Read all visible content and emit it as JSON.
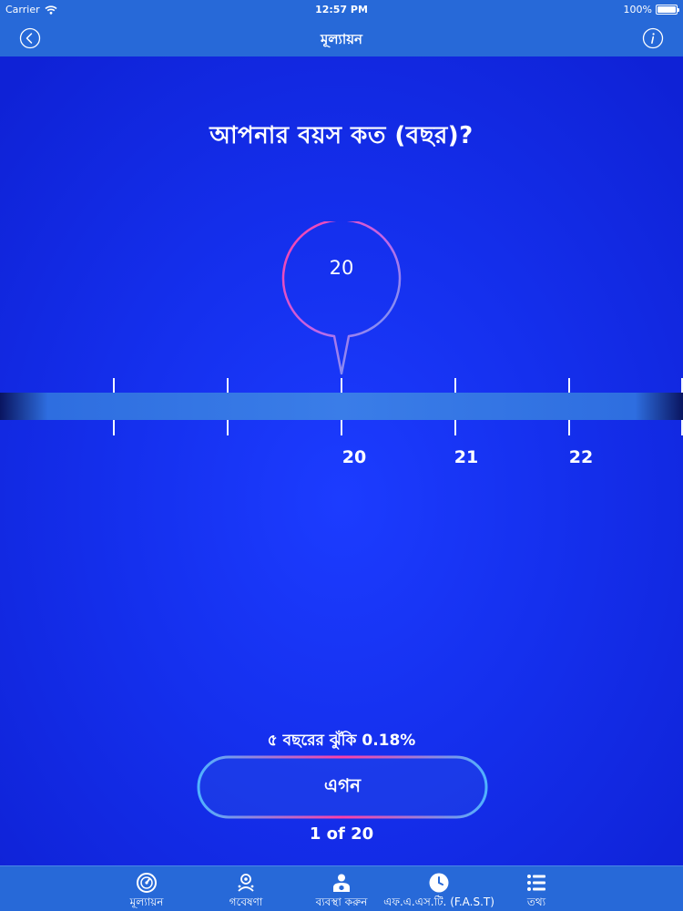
{
  "status_bar": {
    "carrier": "Carrier",
    "time": "12:57 PM",
    "battery": "100%"
  },
  "nav": {
    "title": "মূল্যায়ন",
    "back_icon": "chevron-left-circle-icon",
    "info_icon": "info-circle-icon"
  },
  "question": "আপনার বয়স কত (বছর)?",
  "picker": {
    "selected_value": "20",
    "tick_labels": [
      "20",
      "21",
      "22"
    ]
  },
  "risk_text": "৫ বছরের ঝুঁকি 0.18%",
  "next_button": {
    "label": "এগন"
  },
  "progress": "1 of 20",
  "tabs": [
    {
      "label": "মূল্যায়ন",
      "icon": "gauge-icon"
    },
    {
      "label": "গবেষণা",
      "icon": "research-icon"
    },
    {
      "label": "ব্যবস্থা করুন",
      "icon": "doctor-icon"
    },
    {
      "label": "এফ.এ.এস.টি. (F.A.S.T)",
      "icon": "clock-icon"
    },
    {
      "label": "তথ্য",
      "icon": "list-icon"
    }
  ],
  "colors": {
    "bar": "#2769d8",
    "background": "#1530ee",
    "accent_pink": "#ff3fa8",
    "accent_blue": "#4fb2ff"
  }
}
